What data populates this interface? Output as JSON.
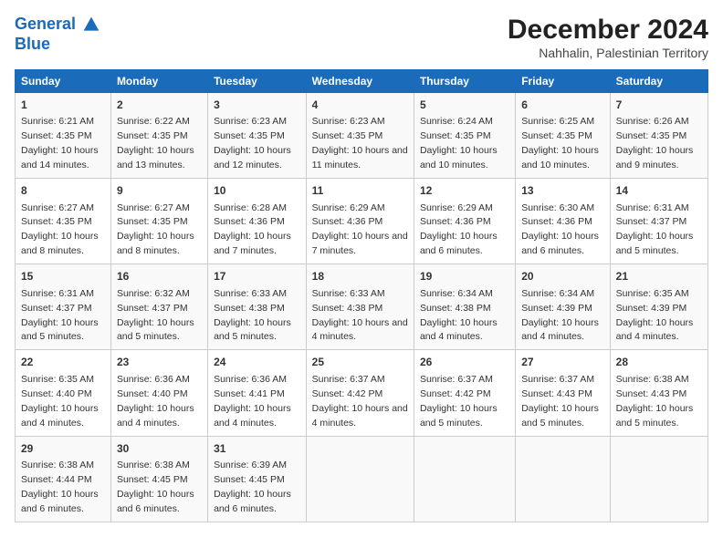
{
  "logo": {
    "line1": "General",
    "line2": "Blue"
  },
  "title": "December 2024",
  "subtitle": "Nahhalin, Palestinian Territory",
  "columns": [
    "Sunday",
    "Monday",
    "Tuesday",
    "Wednesday",
    "Thursday",
    "Friday",
    "Saturday"
  ],
  "weeks": [
    [
      {
        "day": "1",
        "sunrise": "6:21 AM",
        "sunset": "4:35 PM",
        "daylight": "10 hours and 14 minutes."
      },
      {
        "day": "2",
        "sunrise": "6:22 AM",
        "sunset": "4:35 PM",
        "daylight": "10 hours and 13 minutes."
      },
      {
        "day": "3",
        "sunrise": "6:23 AM",
        "sunset": "4:35 PM",
        "daylight": "10 hours and 12 minutes."
      },
      {
        "day": "4",
        "sunrise": "6:23 AM",
        "sunset": "4:35 PM",
        "daylight": "10 hours and 11 minutes."
      },
      {
        "day": "5",
        "sunrise": "6:24 AM",
        "sunset": "4:35 PM",
        "daylight": "10 hours and 10 minutes."
      },
      {
        "day": "6",
        "sunrise": "6:25 AM",
        "sunset": "4:35 PM",
        "daylight": "10 hours and 10 minutes."
      },
      {
        "day": "7",
        "sunrise": "6:26 AM",
        "sunset": "4:35 PM",
        "daylight": "10 hours and 9 minutes."
      }
    ],
    [
      {
        "day": "8",
        "sunrise": "6:27 AM",
        "sunset": "4:35 PM",
        "daylight": "10 hours and 8 minutes."
      },
      {
        "day": "9",
        "sunrise": "6:27 AM",
        "sunset": "4:35 PM",
        "daylight": "10 hours and 8 minutes."
      },
      {
        "day": "10",
        "sunrise": "6:28 AM",
        "sunset": "4:36 PM",
        "daylight": "10 hours and 7 minutes."
      },
      {
        "day": "11",
        "sunrise": "6:29 AM",
        "sunset": "4:36 PM",
        "daylight": "10 hours and 7 minutes."
      },
      {
        "day": "12",
        "sunrise": "6:29 AM",
        "sunset": "4:36 PM",
        "daylight": "10 hours and 6 minutes."
      },
      {
        "day": "13",
        "sunrise": "6:30 AM",
        "sunset": "4:36 PM",
        "daylight": "10 hours and 6 minutes."
      },
      {
        "day": "14",
        "sunrise": "6:31 AM",
        "sunset": "4:37 PM",
        "daylight": "10 hours and 5 minutes."
      }
    ],
    [
      {
        "day": "15",
        "sunrise": "6:31 AM",
        "sunset": "4:37 PM",
        "daylight": "10 hours and 5 minutes."
      },
      {
        "day": "16",
        "sunrise": "6:32 AM",
        "sunset": "4:37 PM",
        "daylight": "10 hours and 5 minutes."
      },
      {
        "day": "17",
        "sunrise": "6:33 AM",
        "sunset": "4:38 PM",
        "daylight": "10 hours and 5 minutes."
      },
      {
        "day": "18",
        "sunrise": "6:33 AM",
        "sunset": "4:38 PM",
        "daylight": "10 hours and 4 minutes."
      },
      {
        "day": "19",
        "sunrise": "6:34 AM",
        "sunset": "4:38 PM",
        "daylight": "10 hours and 4 minutes."
      },
      {
        "day": "20",
        "sunrise": "6:34 AM",
        "sunset": "4:39 PM",
        "daylight": "10 hours and 4 minutes."
      },
      {
        "day": "21",
        "sunrise": "6:35 AM",
        "sunset": "4:39 PM",
        "daylight": "10 hours and 4 minutes."
      }
    ],
    [
      {
        "day": "22",
        "sunrise": "6:35 AM",
        "sunset": "4:40 PM",
        "daylight": "10 hours and 4 minutes."
      },
      {
        "day": "23",
        "sunrise": "6:36 AM",
        "sunset": "4:40 PM",
        "daylight": "10 hours and 4 minutes."
      },
      {
        "day": "24",
        "sunrise": "6:36 AM",
        "sunset": "4:41 PM",
        "daylight": "10 hours and 4 minutes."
      },
      {
        "day": "25",
        "sunrise": "6:37 AM",
        "sunset": "4:42 PM",
        "daylight": "10 hours and 4 minutes."
      },
      {
        "day": "26",
        "sunrise": "6:37 AM",
        "sunset": "4:42 PM",
        "daylight": "10 hours and 5 minutes."
      },
      {
        "day": "27",
        "sunrise": "6:37 AM",
        "sunset": "4:43 PM",
        "daylight": "10 hours and 5 minutes."
      },
      {
        "day": "28",
        "sunrise": "6:38 AM",
        "sunset": "4:43 PM",
        "daylight": "10 hours and 5 minutes."
      }
    ],
    [
      {
        "day": "29",
        "sunrise": "6:38 AM",
        "sunset": "4:44 PM",
        "daylight": "10 hours and 6 minutes."
      },
      {
        "day": "30",
        "sunrise": "6:38 AM",
        "sunset": "4:45 PM",
        "daylight": "10 hours and 6 minutes."
      },
      {
        "day": "31",
        "sunrise": "6:39 AM",
        "sunset": "4:45 PM",
        "daylight": "10 hours and 6 minutes."
      },
      null,
      null,
      null,
      null
    ]
  ]
}
